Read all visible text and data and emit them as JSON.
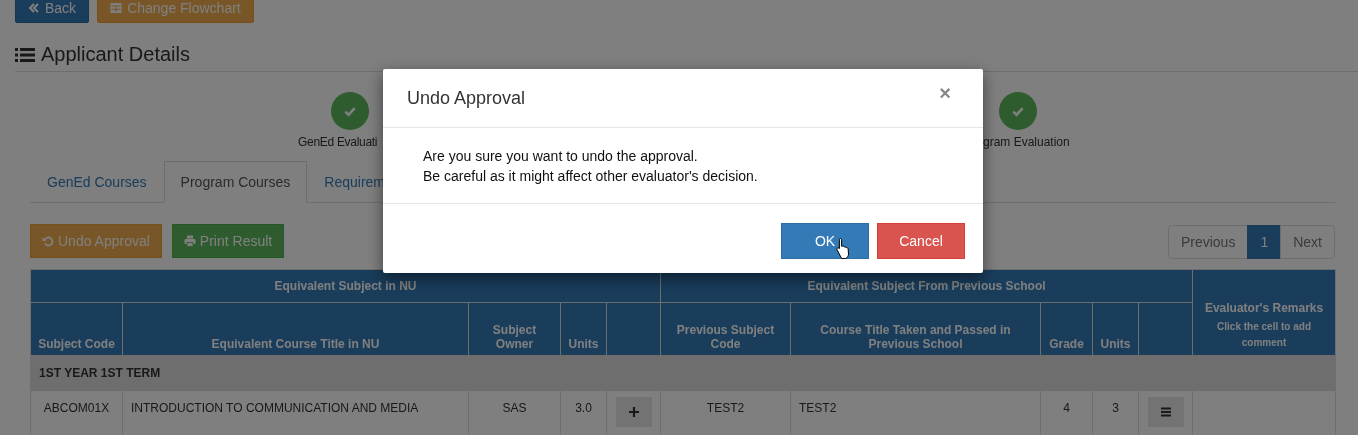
{
  "top_buttons": [
    {
      "kind": "back",
      "label": "Back"
    },
    {
      "kind": "flowchart",
      "label": "Change Flowchart"
    }
  ],
  "heading": "Applicant Details",
  "steps": [
    {
      "label": "GenEd Evaluati",
      "done": true
    },
    {
      "label": "gram Evaluation",
      "done": true
    }
  ],
  "tabs": [
    {
      "label": "GenEd Courses",
      "selected": false
    },
    {
      "label": "Program Courses",
      "selected": true
    },
    {
      "label": "Requirem",
      "selected": false
    }
  ],
  "actions": [
    {
      "kind": "undo",
      "label": "Undo Approval"
    },
    {
      "kind": "print",
      "label": "Print Result"
    }
  ],
  "pagination": [
    {
      "label": "Previous",
      "selected": false
    },
    {
      "label": "1",
      "selected": true
    },
    {
      "label": "Next",
      "selected": false
    }
  ],
  "table": {
    "groups": [
      "Equivalent Subject in NU",
      "Equivalent Subject From Previous School"
    ],
    "remarks_header": {
      "title": "Evaluator's Remarks",
      "hint": "Click the cell to add comment"
    },
    "columns": [
      "Subject Code",
      "Equivalent Course Title in NU",
      "Subject Owner",
      "Units",
      "",
      "Previous Subject Code",
      "Course Title Taken and Passed in Previous School",
      "Grade",
      "Units",
      ""
    ],
    "sections": [
      {
        "term": "1ST YEAR 1ST TERM",
        "rows": [
          {
            "subject_code": "ABCOM01X",
            "title": "INTRODUCTION TO COMMUNICATION AND MEDIA",
            "owner": "SAS",
            "units": "3.0",
            "prev_code": "TEST2",
            "prev_title": "TEST2",
            "grade": "4",
            "prev_units": "3",
            "remarks": ""
          }
        ]
      }
    ]
  },
  "modal": {
    "title": "Undo Approval",
    "close": "×",
    "lines": [
      "Are you sure you want to undo the approval.",
      "Be careful as it might affect other evaluator's decision."
    ],
    "buttons": [
      {
        "kind": "primary",
        "label": "OK"
      },
      {
        "kind": "danger",
        "label": "Cancel"
      }
    ]
  }
}
